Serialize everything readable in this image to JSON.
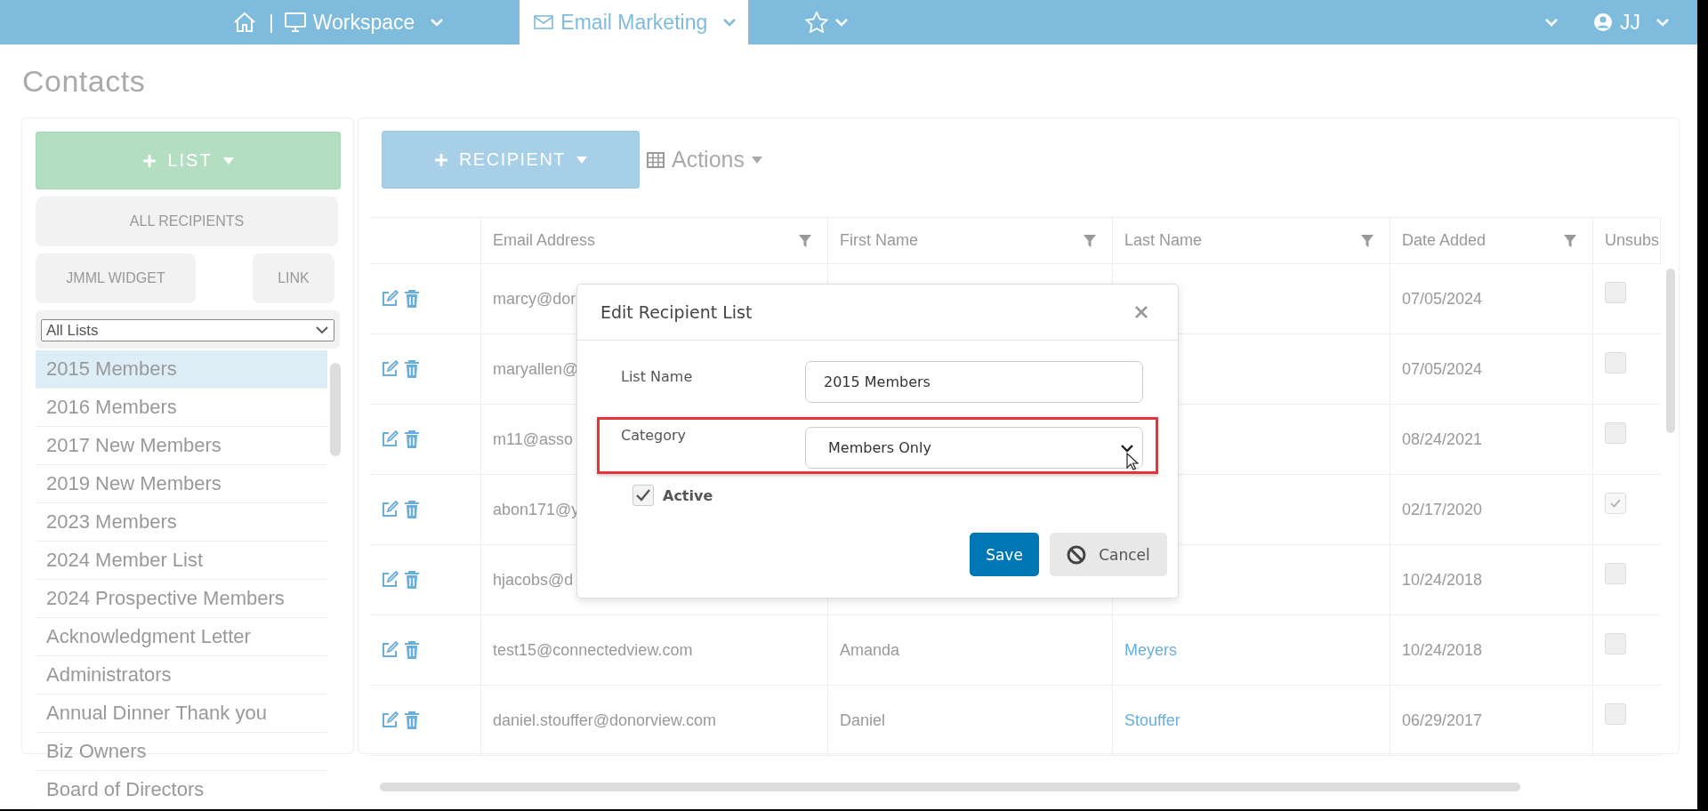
{
  "top_nav": {
    "separator": "|",
    "items": [
      {
        "kind": "workspace",
        "label": "Workspace",
        "selected": false
      },
      {
        "kind": "email",
        "label": "Email Marketing",
        "selected": true
      },
      {
        "kind": "favorites",
        "selected": false
      }
    ],
    "user": {
      "label": "JJ"
    }
  },
  "page_title": "Contacts",
  "sidebar": {
    "new_list_button": "LIST",
    "buttons": [
      "ALL RECIPIENTS",
      "JMML WIDGET",
      "LINK"
    ],
    "filter": {
      "value": "All Lists"
    },
    "lists": [
      {
        "label": "2015 Members",
        "selected": true
      },
      {
        "label": "2016 Members",
        "selected": false
      },
      {
        "label": "2017 New Members",
        "selected": false
      },
      {
        "label": "2019 New Members",
        "selected": false
      },
      {
        "label": "2023 Members",
        "selected": false
      },
      {
        "label": "2024 Member List",
        "selected": false
      },
      {
        "label": "2024 Prospective Members",
        "selected": false
      },
      {
        "label": "Acknowledgment Letter",
        "selected": false
      },
      {
        "label": "Administrators",
        "selected": false
      },
      {
        "label": "Annual Dinner Thank you",
        "selected": false
      },
      {
        "label": "Biz Owners",
        "selected": false
      },
      {
        "label": "Board of Directors",
        "selected": false
      }
    ]
  },
  "toolbar": {
    "recipient_button": "RECIPIENT",
    "actions": "Actions"
  },
  "table": {
    "columns": [
      {
        "label": "Email Address",
        "filter": true
      },
      {
        "label": "First Name",
        "filter": true
      },
      {
        "label": "Last Name",
        "filter": true
      },
      {
        "label": "Date Added",
        "filter": true
      },
      {
        "label": "Unsubs",
        "filter": false
      }
    ],
    "rows": [
      {
        "email": "marcy@dor",
        "date": "07/05/2024",
        "unsubscribed": false
      },
      {
        "email": "maryallen@",
        "date": "07/05/2024",
        "unsubscribed": false
      },
      {
        "email": "m11@asso",
        "date": "08/24/2021",
        "unsubscribed": false
      },
      {
        "email": "abon171@y",
        "date": "02/17/2020",
        "unsubscribed": true
      },
      {
        "email": "hjacobs@d",
        "date": "10/24/2018",
        "unsubscribed": false
      },
      {
        "email": "test15@connectedview.com",
        "first_name": "Amanda",
        "last_name": "Meyers",
        "date": "10/24/2018",
        "unsubscribed": false
      },
      {
        "email": "daniel.stouffer@donorview.com",
        "first_name": "Daniel",
        "last_name": "Stouffer",
        "date": "06/29/2017",
        "unsubscribed": false
      }
    ]
  },
  "dialog": {
    "title": "Edit Recipient List",
    "fields": [
      {
        "kind": "text",
        "label": "List Name",
        "value": "2015 Members",
        "highlighted": false
      },
      {
        "kind": "select",
        "label": "Category",
        "value": "Members Only",
        "highlighted": true
      }
    ],
    "active": {
      "label": "Active",
      "checked": true
    },
    "save_button": "Save",
    "cancel_button": "Cancel"
  }
}
